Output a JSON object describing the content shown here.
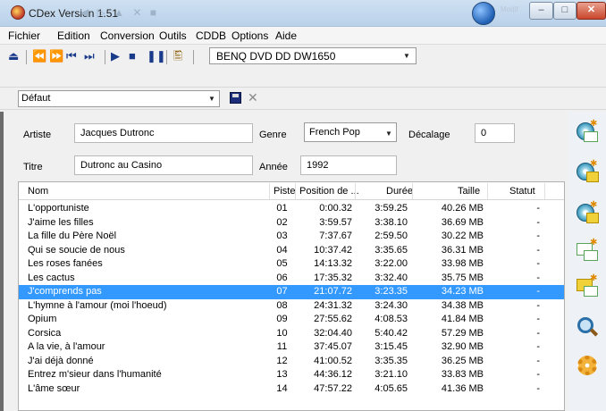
{
  "window": {
    "title": "CDex Version 1.51",
    "orb_label": "Modif"
  },
  "menu": [
    "Fichier",
    "Edition",
    "Conversion",
    "Outils",
    "CDDB",
    "Options",
    "Aide"
  ],
  "toolbar": {
    "drive": "BENQ  DVD DD DW1650",
    "profile": "Défaut"
  },
  "form": {
    "artist_label": "Artiste",
    "artist_value": "Jacques Dutronc",
    "title_label": "Titre",
    "title_value": "Dutronc au Casino",
    "genre_label": "Genre",
    "genre_value": "French Pop",
    "year_label": "Année",
    "year_value": "1992",
    "offset_label": "Décalage",
    "offset_value": "0"
  },
  "table": {
    "headers": {
      "nom": "Nom",
      "piste": "Piste",
      "position": "Position de ...",
      "duree": "Durée",
      "taille": "Taille",
      "statut": "Statut"
    },
    "rows": [
      {
        "nom": "L'opportuniste",
        "piste": "01",
        "position": "0:00.32",
        "duree": "3:59.25",
        "taille": "40.26 MB",
        "statut": "-"
      },
      {
        "nom": "J'aime les filles",
        "piste": "02",
        "position": "3:59.57",
        "duree": "3:38.10",
        "taille": "36.69 MB",
        "statut": "-"
      },
      {
        "nom": "La fille du Père Noël",
        "piste": "03",
        "position": "7:37.67",
        "duree": "2:59.50",
        "taille": "30.22 MB",
        "statut": "-"
      },
      {
        "nom": "Qui se soucie de nous",
        "piste": "04",
        "position": "10:37.42",
        "duree": "3:35.65",
        "taille": "36.31 MB",
        "statut": "-"
      },
      {
        "nom": "Les roses fanées",
        "piste": "05",
        "position": "14:13.32",
        "duree": "3:22.00",
        "taille": "33.98 MB",
        "statut": "-"
      },
      {
        "nom": "Les cactus",
        "piste": "06",
        "position": "17:35.32",
        "duree": "3:32.40",
        "taille": "35.75 MB",
        "statut": "-"
      },
      {
        "nom": "J'comprends pas",
        "piste": "07",
        "position": "21:07.72",
        "duree": "3:23.35",
        "taille": "34.23 MB",
        "statut": "-",
        "selected": true
      },
      {
        "nom": "L'hymne à l'amour (moi l'hoeud)",
        "piste": "08",
        "position": "24:31.32",
        "duree": "3:24.30",
        "taille": "34.38 MB",
        "statut": "-"
      },
      {
        "nom": "Opium",
        "piste": "09",
        "position": "27:55.62",
        "duree": "4:08.53",
        "taille": "41.84 MB",
        "statut": "-"
      },
      {
        "nom": "Corsica",
        "piste": "10",
        "position": "32:04.40",
        "duree": "5:40.42",
        "taille": "57.29 MB",
        "statut": "-"
      },
      {
        "nom": "A la vie, à l'amour",
        "piste": "11",
        "position": "37:45.07",
        "duree": "3:15.45",
        "taille": "32.90 MB",
        "statut": "-"
      },
      {
        "nom": "J'ai déjà donné",
        "piste": "12",
        "position": "41:00.52",
        "duree": "3:35.35",
        "taille": "36.25 MB",
        "statut": "-"
      },
      {
        "nom": "Entrez m'sieur dans l'humanité",
        "piste": "13",
        "position": "44:36.12",
        "duree": "3:21.10",
        "taille": "33.83 MB",
        "statut": "-"
      },
      {
        "nom": "L'âme sœur",
        "piste": "14",
        "position": "47:57.22",
        "duree": "4:05.65",
        "taille": "41.36 MB",
        "statut": "-"
      }
    ]
  },
  "colors": {
    "selection": "#3399ff",
    "titlebar": "#b9d1ea"
  }
}
